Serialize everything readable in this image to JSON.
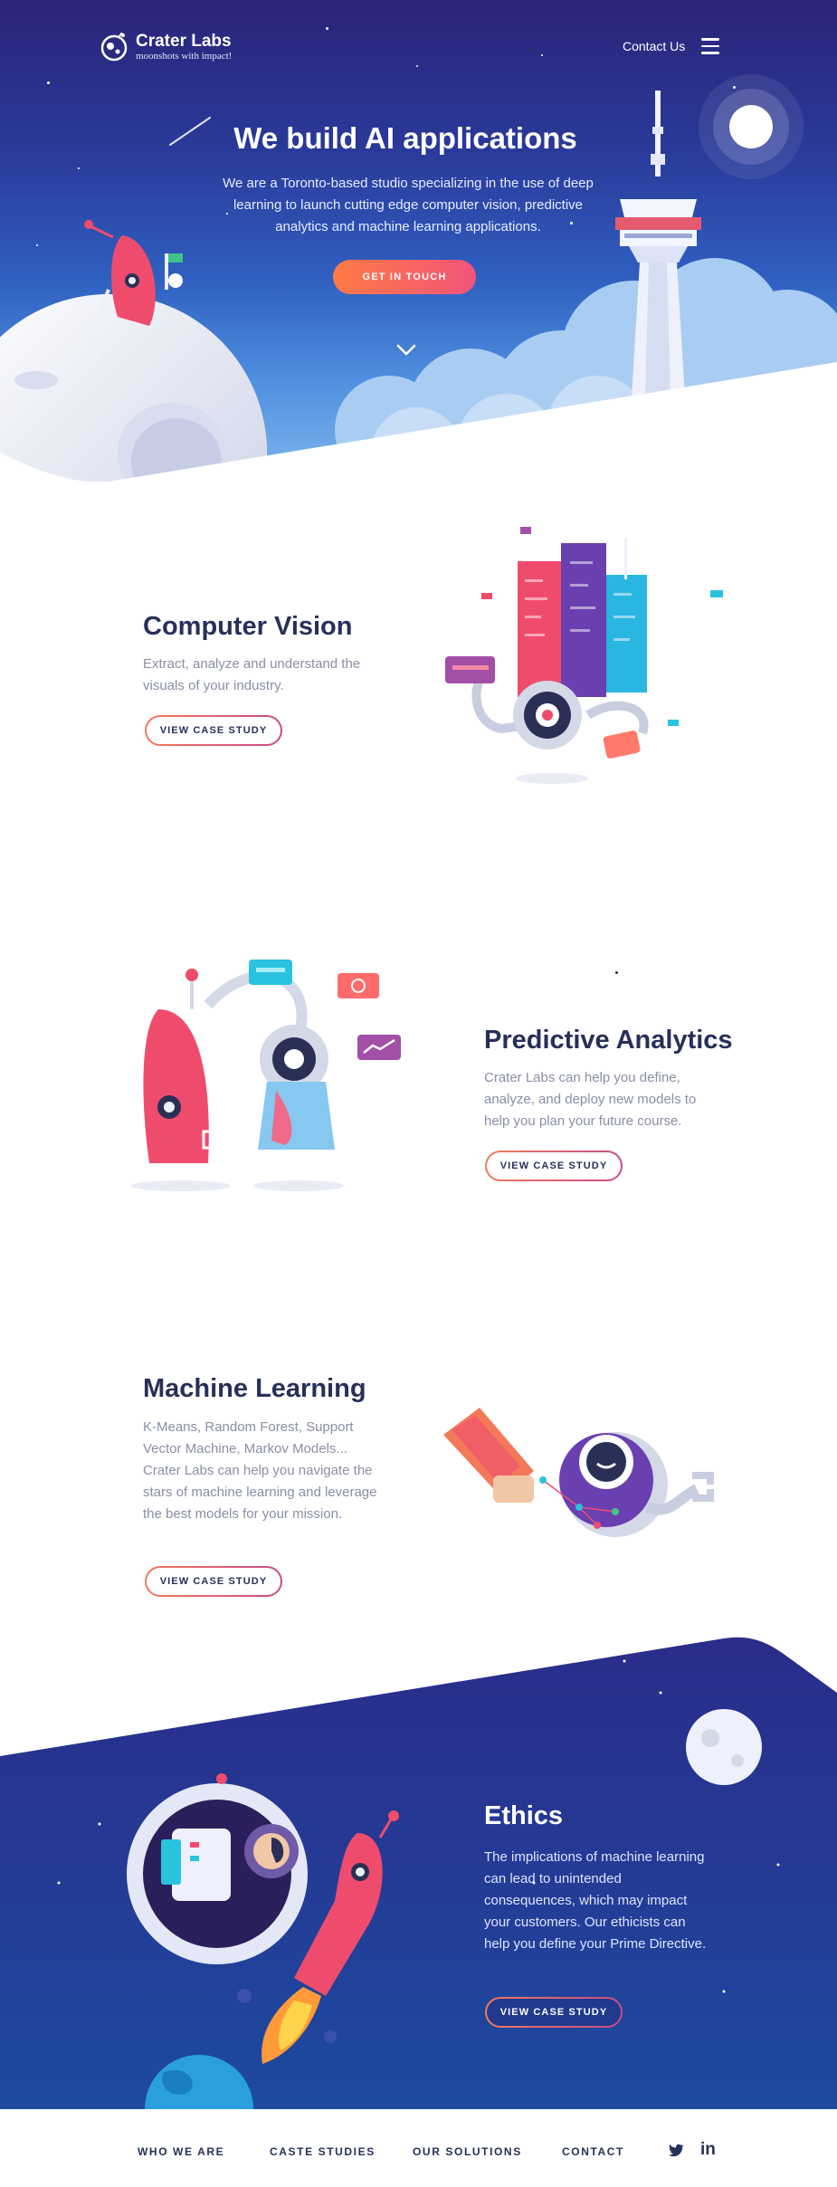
{
  "header": {
    "logo_name": "Crater Labs",
    "logo_tagline": "moonshots with impact!",
    "contact_label": "Contact Us",
    "menu_icon": "hamburger-menu-icon"
  },
  "hero": {
    "title": "We build AI applications",
    "description": "We are a Toronto-based studio specializing in the use of deep learning to launch cutting edge computer vision, predictive analytics and machine learning applications.",
    "cta_label": "GET IN TOUCH",
    "scroll_icon": "chevron-down-icon"
  },
  "sections": [
    {
      "title": "Computer Vision",
      "text": "Extract, analyze and understand the visuals of your industry.",
      "button": "VIEW CASE STUDY"
    },
    {
      "title": "Predictive Analytics",
      "text": "Crater Labs can help you define, analyze, and deploy new models to help you plan your future course.",
      "button": "VIEW CASE STUDY"
    },
    {
      "title": "Machine Learning",
      "text": "K-Means, Random Forest, Support Vector Machine, Markov Models... Crater Labs can help you navigate the stars of machine learning and leverage the best models for your mission.",
      "button": "VIEW CASE STUDY"
    },
    {
      "title": "Ethics",
      "text": "The implications of machine learning can lead to unintended consequences, which may impact your customers. Our ethicists can help you define your Prime Directive.",
      "button": "VIEW CASE STUDY"
    }
  ],
  "footer": {
    "links": [
      "WHO WE ARE",
      "CASTE STUDIES",
      "OUR SOLUTIONS",
      "CONTACT"
    ],
    "social_icons": [
      "twitter-icon",
      "linkedin-icon"
    ],
    "linkedin_text": "in"
  },
  "colors": {
    "hero_top": "#2a2478",
    "hero_bottom": "#8cc0f0",
    "accent_orange": "#ff7a45",
    "accent_pink": "#f2547a",
    "heading": "#27305a",
    "body_text": "#8a8fa6",
    "ethics_bg": "#223c93"
  }
}
